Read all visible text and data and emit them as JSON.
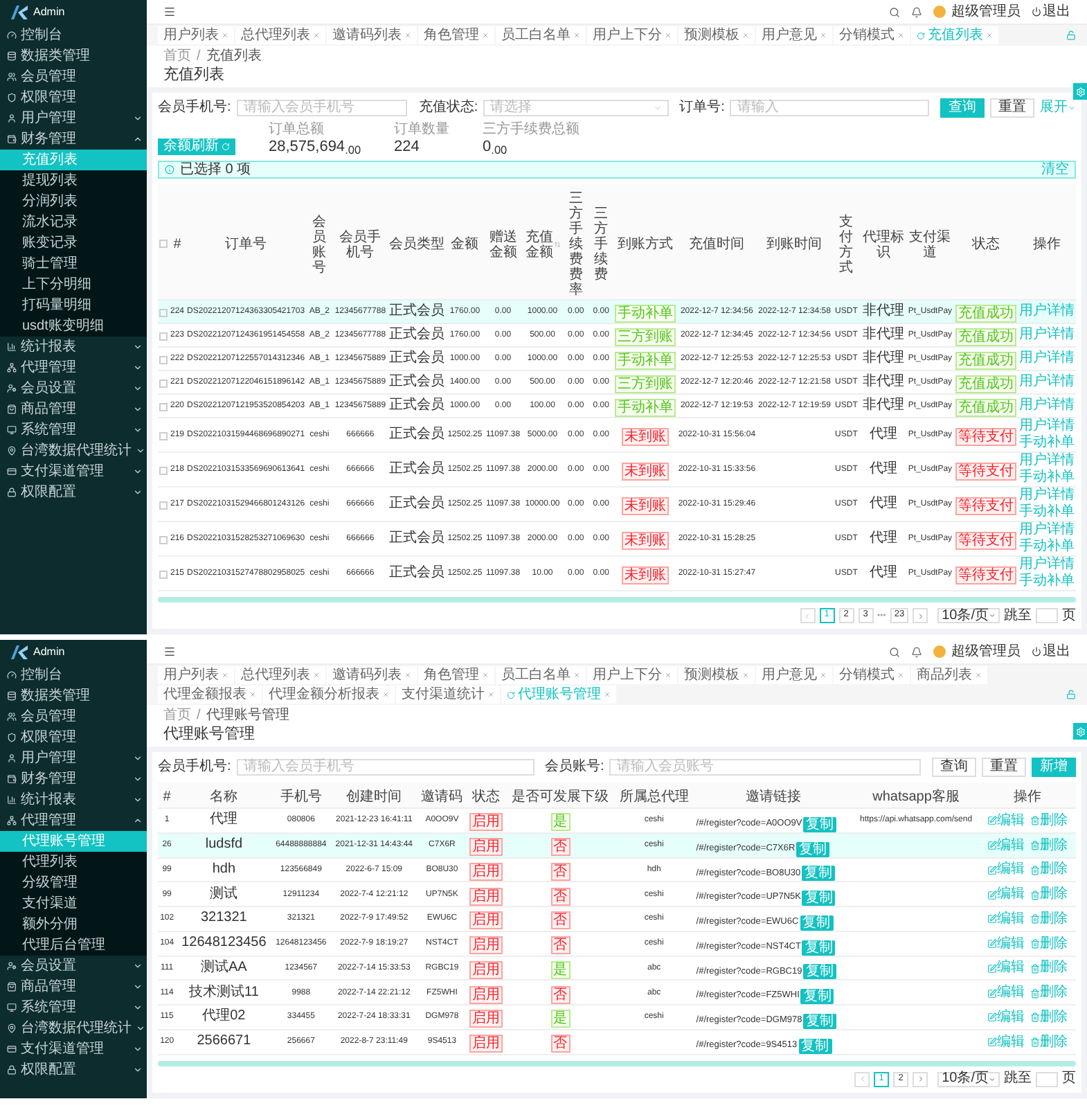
{
  "screens": [
    {
      "logo": "Admin",
      "sidebar": {
        "items": [
          {
            "label": "控制台",
            "kind": "link",
            "selected": false
          },
          {
            "label": "数据类管理",
            "kind": "link",
            "selected": false
          },
          {
            "label": "会员管理",
            "kind": "link",
            "selected": false
          },
          {
            "label": "权限管理",
            "kind": "link",
            "selected": false
          },
          {
            "label": "用户管理",
            "kind": "group",
            "expanded": false,
            "selected": false
          },
          {
            "label": "财务管理",
            "kind": "group",
            "expanded": true,
            "selected": false,
            "children": [
              {
                "label": "充值列表",
                "selected": true
              },
              {
                "label": "提现列表",
                "selected": false
              },
              {
                "label": "分润列表",
                "selected": false
              },
              {
                "label": "流水记录",
                "selected": false
              },
              {
                "label": "账变记录",
                "selected": false
              },
              {
                "label": "骑士管理",
                "selected": false
              },
              {
                "label": "上下分明细",
                "selected": false
              },
              {
                "label": "打码量明细",
                "selected": false
              },
              {
                "label": "usdt账变明细",
                "selected": false
              }
            ]
          },
          {
            "label": "统计报表",
            "kind": "group",
            "expanded": false,
            "selected": false
          },
          {
            "label": "代理管理",
            "kind": "group",
            "expanded": false,
            "selected": false
          },
          {
            "label": "会员设置",
            "kind": "group",
            "expanded": false,
            "selected": false
          },
          {
            "label": "商品管理",
            "kind": "group",
            "expanded": false,
            "selected": false
          },
          {
            "label": "系统管理",
            "kind": "group",
            "expanded": false,
            "selected": false
          },
          {
            "label": "台湾数据代理统计",
            "kind": "group",
            "expanded": false,
            "selected": false
          },
          {
            "label": "支付渠道管理",
            "kind": "group",
            "expanded": false,
            "selected": false
          },
          {
            "label": "权限配置",
            "kind": "group",
            "expanded": false,
            "selected": false
          }
        ]
      },
      "user": "超级管理员",
      "logout": "退出",
      "tabs": [
        {
          "label": "用户列表",
          "selected": false
        },
        {
          "label": "总代理列表",
          "selected": false
        },
        {
          "label": "邀请码列表",
          "selected": false
        },
        {
          "label": "角色管理",
          "selected": false
        },
        {
          "label": "员工白名单",
          "selected": false
        },
        {
          "label": "用户上下分",
          "selected": false
        },
        {
          "label": "预测模板",
          "selected": false
        },
        {
          "label": "用户意见",
          "selected": false
        },
        {
          "label": "分销模式",
          "selected": false
        },
        {
          "label": "充值列表",
          "selected": true
        }
      ],
      "breadcrumb": {
        "separator": "/",
        "items": [
          "首页",
          "充值列表"
        ]
      },
      "title": "充值列表",
      "filters": [
        {
          "label": "会员手机号:",
          "kind": "input",
          "placeholder": "请输入会员手机号"
        },
        {
          "label": "充值状态:",
          "kind": "select",
          "placeholder": "请选择"
        },
        {
          "label": "订单号:",
          "kind": "input",
          "placeholder": "请输入"
        }
      ],
      "filter_buttons": [
        {
          "label": "查询",
          "kind": "primary"
        },
        {
          "label": "重置",
          "kind": "default"
        },
        {
          "label": "展开",
          "kind": "link"
        }
      ],
      "refresh_button": "余额刷新",
      "stats": [
        {
          "label": "订单总额",
          "value": "28,575,694$_{.00}$"
        },
        {
          "label": "订单数量",
          "value": "224"
        },
        {
          "label": "三方手续费总额",
          "value": "0$_{.00}$"
        }
      ],
      "selection": {
        "text": "已选择 0 项",
        "clear": "清空"
      },
      "table": {
        "checkboxes": true,
        "all_checked": false,
        "columns": [
          {
            "label": "#",
            "kind": "num"
          },
          {
            "label": "订单号",
            "kind": "num"
          },
          {
            "label": "会员账号",
            "kind": "num"
          },
          {
            "label": "会员手机号",
            "kind": "num"
          },
          {
            "label": "会员类型",
            "kind": "cjk"
          },
          {
            "label": "金额",
            "kind": "num"
          },
          {
            "label": "赠送金额",
            "kind": "num"
          },
          {
            "label": "充值金额",
            "kind": "num",
            "sortable": true
          },
          {
            "label": "三方手续费费率",
            "kind": "num"
          },
          {
            "label": "三方手续费",
            "kind": "num"
          },
          {
            "label": "到账方式",
            "kind": "tag"
          },
          {
            "label": "充值时间",
            "kind": "num"
          },
          {
            "label": "到账时间",
            "kind": "num"
          },
          {
            "label": "支付方式",
            "kind": "num"
          },
          {
            "label": "代理标识",
            "kind": "cjk"
          },
          {
            "label": "支付渠道",
            "kind": "num"
          },
          {
            "label": "状态",
            "kind": "tag"
          },
          {
            "label": "操作",
            "kind": "actions"
          }
        ],
        "rows": [
          {
            "checked": false,
            "highlighted": true,
            "cells": [
              "224",
              "DS20221207124363305421703",
              "AB_2",
              "12345677788",
              "正式会员",
              "1760.00",
              "0.00",
              "1000.00",
              "0.00",
              "0.00",
              {
                "text": "手动补单",
                "kind": "success"
              },
              "2022-12-7 12:34:56",
              "2022-12-7 12:34:58",
              "USDT",
              "非代理",
              "Pt_UsdtPay",
              {
                "text": "充值成功",
                "kind": "success"
              },
              [
                "用户详情"
              ]
            ]
          },
          {
            "checked": false,
            "highlighted": false,
            "cells": [
              "223",
              "DS20221207124361951454558",
              "AB_2",
              "12345677788",
              "正式会员",
              "1760.00",
              "0.00",
              "500.00",
              "0.00",
              "0.00",
              {
                "text": "三方到账",
                "kind": "success"
              },
              "2022-12-7 12:34:45",
              "2022-12-7 12:34:56",
              "USDT",
              "非代理",
              "Pt_UsdtPay",
              {
                "text": "充值成功",
                "kind": "success"
              },
              [
                "用户详情"
              ]
            ]
          },
          {
            "checked": false,
            "highlighted": false,
            "cells": [
              "222",
              "DS20221207122557014312346",
              "AB_1",
              "12345675889",
              "正式会员",
              "1000.00",
              "0.00",
              "1000.00",
              "0.00",
              "0.00",
              {
                "text": "手动补单",
                "kind": "success"
              },
              "2022-12-7 12:25:53",
              "2022-12-7 12:25:53",
              "USDT",
              "非代理",
              "Pt_UsdtPay",
              {
                "text": "充值成功",
                "kind": "success"
              },
              [
                "用户详情"
              ]
            ]
          },
          {
            "checked": false,
            "highlighted": false,
            "cells": [
              "221",
              "DS20221207122046151896142",
              "AB_1",
              "12345675889",
              "正式会员",
              "1400.00",
              "0.00",
              "500.00",
              "0.00",
              "0.00",
              {
                "text": "三方到账",
                "kind": "success"
              },
              "2022-12-7 12:20:46",
              "2022-12-7 12:21:58",
              "USDT",
              "非代理",
              "Pt_UsdtPay",
              {
                "text": "充值成功",
                "kind": "success"
              },
              [
                "用户详情"
              ]
            ]
          },
          {
            "checked": false,
            "highlighted": false,
            "cells": [
              "220",
              "DS20221207121953520854203",
              "AB_1",
              "12345675889",
              "正式会员",
              "1000.00",
              "0.00",
              "100.00",
              "0.00",
              "0.00",
              {
                "text": "手动补单",
                "kind": "success"
              },
              "2022-12-7 12:19:53",
              "2022-12-7 12:19:59",
              "USDT",
              "非代理",
              "Pt_UsdtPay",
              {
                "text": "充值成功",
                "kind": "success"
              },
              [
                "用户详情"
              ]
            ]
          },
          {
            "checked": false,
            "highlighted": false,
            "cells": [
              "219",
              "DS20221031594468696890271",
              "ceshi",
              "666666",
              "正式会员",
              "12502.25",
              "11097.38",
              "5000.00",
              "0.00",
              "0.00",
              {
                "text": "未到账",
                "kind": "danger"
              },
              "2022-10-31 15:56:04",
              null,
              "USDT",
              "代理",
              "Pt_UsdtPay",
              {
                "text": "等待支付",
                "kind": "danger"
              },
              [
                "用户详情",
                "手动补单"
              ]
            ]
          },
          {
            "checked": false,
            "highlighted": false,
            "cells": [
              "218",
              "DS20221031533569690613641",
              "ceshi",
              "666666",
              "正式会员",
              "12502.25",
              "11097.38",
              "2000.00",
              "0.00",
              "0.00",
              {
                "text": "未到账",
                "kind": "danger"
              },
              "2022-10-31 15:33:56",
              null,
              "USDT",
              "代理",
              "Pt_UsdtPay",
              {
                "text": "等待支付",
                "kind": "danger"
              },
              [
                "用户详情",
                "手动补单"
              ]
            ]
          },
          {
            "checked": false,
            "highlighted": false,
            "cells": [
              "217",
              "DS20221031529466801243126",
              "ceshi",
              "666666",
              "正式会员",
              "12502.25",
              "11097.38",
              "10000.00",
              "0.00",
              "0.00",
              {
                "text": "未到账",
                "kind": "danger"
              },
              "2022-10-31 15:29:46",
              null,
              "USDT",
              "代理",
              "Pt_UsdtPay",
              {
                "text": "等待支付",
                "kind": "danger"
              },
              [
                "用户详情",
                "手动补单"
              ]
            ]
          },
          {
            "checked": false,
            "highlighted": false,
            "cells": [
              "216",
              "DS20221031528253271069630",
              "ceshi",
              "666666",
              "正式会员",
              "12502.25",
              "11097.38",
              "2000.00",
              "0.00",
              "0.00",
              {
                "text": "未到账",
                "kind": "danger"
              },
              "2022-10-31 15:28:25",
              null,
              "USDT",
              "代理",
              "Pt_UsdtPay",
              {
                "text": "等待支付",
                "kind": "danger"
              },
              [
                "用户详情",
                "手动补单"
              ]
            ]
          },
          {
            "checked": false,
            "highlighted": false,
            "cells": [
              "215",
              "DS20221031527478802958025",
              "ceshi",
              "666666",
              "正式会员",
              "12502.25",
              "11097.38",
              "10.00",
              "0.00",
              "0.00",
              {
                "text": "未到账",
                "kind": "danger"
              },
              "2022-10-31 15:27:47",
              null,
              "USDT",
              "代理",
              "Pt_UsdtPay",
              {
                "text": "等待支付",
                "kind": "danger"
              },
              [
                "用户详情",
                "手动补单"
              ]
            ]
          }
        ]
      },
      "pagination": {
        "items": [
          {
            "label": "1",
            "kind": "page",
            "selected": true
          },
          {
            "label": "2",
            "kind": "page",
            "selected": false
          },
          {
            "label": "3",
            "kind": "page",
            "selected": false
          },
          {
            "label": "•••",
            "kind": "ellipsis",
            "selected": false
          },
          {
            "label": "23",
            "kind": "page",
            "selected": false
          }
        ],
        "page_size": "10条/页",
        "jump": "跳至",
        "unit": "页"
      }
    },
    {
      "logo": "Admin",
      "sidebar": {
        "items": [
          {
            "label": "控制台",
            "kind": "link",
            "selected": false
          },
          {
            "label": "数据类管理",
            "kind": "link",
            "selected": false
          },
          {
            "label": "会员管理",
            "kind": "link",
            "selected": false
          },
          {
            "label": "权限管理",
            "kind": "link",
            "selected": false
          },
          {
            "label": "用户管理",
            "kind": "group",
            "expanded": false,
            "selected": false
          },
          {
            "label": "财务管理",
            "kind": "group",
            "expanded": false,
            "selected": false
          },
          {
            "label": "统计报表",
            "kind": "group",
            "expanded": false,
            "selected": false
          },
          {
            "label": "代理管理",
            "kind": "group",
            "expanded": true,
            "selected": false,
            "children": [
              {
                "label": "代理账号管理",
                "selected": true
              },
              {
                "label": "代理列表",
                "selected": false
              },
              {
                "label": "分级管理",
                "selected": false
              },
              {
                "label": "支付渠道",
                "selected": false
              },
              {
                "label": "额外分佣",
                "selected": false
              },
              {
                "label": "代理后台管理",
                "selected": false
              }
            ]
          },
          {
            "label": "会员设置",
            "kind": "group",
            "expanded": false,
            "selected": false
          },
          {
            "label": "商品管理",
            "kind": "group",
            "expanded": false,
            "selected": false
          },
          {
            "label": "系统管理",
            "kind": "group",
            "expanded": false,
            "selected": false
          },
          {
            "label": "台湾数据代理统计",
            "kind": "group",
            "expanded": false,
            "selected": false
          },
          {
            "label": "支付渠道管理",
            "kind": "group",
            "expanded": false,
            "selected": false
          },
          {
            "label": "权限配置",
            "kind": "group",
            "expanded": false,
            "selected": false
          }
        ]
      },
      "user": "超级管理员",
      "logout": "退出",
      "tabs": [
        {
          "label": "用户列表",
          "selected": false
        },
        {
          "label": "总代理列表",
          "selected": false
        },
        {
          "label": "邀请码列表",
          "selected": false
        },
        {
          "label": "角色管理",
          "selected": false
        },
        {
          "label": "员工白名单",
          "selected": false
        },
        {
          "label": "用户上下分",
          "selected": false
        },
        {
          "label": "预测模板",
          "selected": false
        },
        {
          "label": "用户意见",
          "selected": false
        },
        {
          "label": "分销模式",
          "selected": false
        },
        {
          "label": "商品列表",
          "selected": false
        },
        {
          "label": "代理金额报表",
          "selected": false
        },
        {
          "label": "代理金额分析报表",
          "selected": false
        },
        {
          "label": "支付渠道统计",
          "selected": false
        },
        {
          "label": "代理账号管理",
          "selected": true
        }
      ],
      "breadcrumb": {
        "separator": "/",
        "items": [
          "首页",
          "代理账号管理"
        ]
      },
      "title": "代理账号管理",
      "filters": [
        {
          "label": "会员手机号:",
          "kind": "input",
          "placeholder": "请输入会员手机号"
        },
        {
          "label": "会员账号:",
          "kind": "input",
          "placeholder": "请输入会员账号"
        }
      ],
      "filter_buttons": [
        {
          "label": "查询",
          "kind": "default"
        },
        {
          "label": "重置",
          "kind": "default"
        },
        {
          "label": "新增",
          "kind": "primary"
        }
      ],
      "table": {
        "columns": [
          {
            "label": "#",
            "kind": "num"
          },
          {
            "label": "名称",
            "kind": "cjk"
          },
          {
            "label": "手机号",
            "kind": "num"
          },
          {
            "label": "创建时间",
            "kind": "num"
          },
          {
            "label": "邀请码",
            "kind": "num"
          },
          {
            "label": "状态",
            "kind": "tag"
          },
          {
            "label": "是否可发展下级",
            "kind": "tag"
          },
          {
            "label": "所属总代理",
            "kind": "num"
          },
          {
            "label": "邀请链接",
            "kind": "link"
          },
          {
            "label": "whatsapp客服",
            "kind": "num"
          },
          {
            "label": "操作",
            "kind": "icon-actions"
          }
        ],
        "rows": [
          {
            "highlighted": false,
            "cells": [
              "1",
              "代理",
              "080806",
              "2021-12-23 16:41:11",
              "A0OO9V",
              {
                "text": "启用",
                "kind": "danger"
              },
              {
                "text": "是",
                "kind": "success"
              },
              "ceshi",
              {
                "text": "/#/register?code=A0OO9V",
                "button": "复制"
              },
              "https://api.whatsapp.com/send",
              [
                "编辑",
                "删除"
              ]
            ]
          },
          {
            "highlighted": true,
            "cells": [
              "26",
              "ludsfd",
              "64488888884",
              "2021-12-31 14:43:44",
              "C7X6R",
              {
                "text": "启用",
                "kind": "danger"
              },
              {
                "text": "否",
                "kind": "danger"
              },
              "ceshi",
              {
                "text": "/#/register?code=C7X6R",
                "button": "复制"
              },
              null,
              [
                "编辑",
                "删除"
              ]
            ]
          },
          {
            "highlighted": false,
            "cells": [
              "99",
              "hdh",
              "123566849",
              "2022-6-7 15:09",
              "BO8U30",
              {
                "text": "启用",
                "kind": "danger"
              },
              {
                "text": "否",
                "kind": "danger"
              },
              "hdh",
              {
                "text": "/#/register?code=BO8U30",
                "button": "复制"
              },
              null,
              [
                "编辑",
                "删除"
              ]
            ]
          },
          {
            "highlighted": false,
            "cells": [
              "99",
              "测试",
              "12911234",
              "2022-7-4 12:21:12",
              "UP7N5K",
              {
                "text": "启用",
                "kind": "danger"
              },
              {
                "text": "否",
                "kind": "danger"
              },
              "ceshi",
              {
                "text": "/#/register?code=UP7N5K",
                "button": "复制"
              },
              null,
              [
                "编辑",
                "删除"
              ]
            ]
          },
          {
            "highlighted": false,
            "cells": [
              "102",
              "321321",
              "321321",
              "2022-7-9 17:49:52",
              "EWU6C",
              {
                "text": "启用",
                "kind": "danger"
              },
              {
                "text": "否",
                "kind": "danger"
              },
              "ceshi",
              {
                "text": "/#/register?code=EWU6C",
                "button": "复制"
              },
              null,
              [
                "编辑",
                "删除"
              ]
            ]
          },
          {
            "highlighted": false,
            "cells": [
              "104",
              "12648123456",
              "12648123456",
              "2022-7-9 18:19:27",
              "NST4CT",
              {
                "text": "启用",
                "kind": "danger"
              },
              {
                "text": "否",
                "kind": "danger"
              },
              "ceshi",
              {
                "text": "/#/register?code=NST4CT",
                "button": "复制"
              },
              null,
              [
                "编辑",
                "删除"
              ]
            ]
          },
          {
            "highlighted": false,
            "cells": [
              "111",
              "测试AA",
              "1234567",
              "2022-7-14 15:33:53",
              "RGBC19",
              {
                "text": "启用",
                "kind": "danger"
              },
              {
                "text": "是",
                "kind": "success"
              },
              "abc",
              {
                "text": "/#/register?code=RGBC19",
                "button": "复制"
              },
              null,
              [
                "编辑",
                "删除"
              ]
            ]
          },
          {
            "highlighted": false,
            "cells": [
              "114",
              "技术测试11",
              "9988",
              "2022-7-14 22:21:12",
              "FZ5WHI",
              {
                "text": "启用",
                "kind": "danger"
              },
              {
                "text": "否",
                "kind": "danger"
              },
              "abc",
              {
                "text": "/#/register?code=FZ5WHI",
                "button": "复制"
              },
              null,
              [
                "编辑",
                "删除"
              ]
            ]
          },
          {
            "highlighted": false,
            "cells": [
              "115",
              "代理02",
              "334455",
              "2022-7-24 18:33:31",
              "DGM978",
              {
                "text": "启用",
                "kind": "danger"
              },
              {
                "text": "是",
                "kind": "success"
              },
              "ceshi",
              {
                "text": "/#/register?code=DGM978",
                "button": "复制"
              },
              null,
              [
                "编辑",
                "删除"
              ]
            ]
          },
          {
            "highlighted": false,
            "cells": [
              "120",
              "2566671",
              "256667",
              "2022-8-7 23:11:49",
              "9S4513",
              {
                "text": "启用",
                "kind": "danger"
              },
              {
                "text": "否",
                "kind": "danger"
              },
              null,
              {
                "text": "/#/register?code=9S4513",
                "button": "复制"
              },
              null,
              [
                "编辑",
                "删除"
              ]
            ]
          }
        ]
      },
      "pagination": {
        "items": [
          {
            "label": "1",
            "kind": "page",
            "selected": true
          },
          {
            "label": "2",
            "kind": "page",
            "selected": false
          }
        ],
        "page_size": "10条/页",
        "jump": "跳至",
        "unit": "页"
      }
    }
  ]
}
